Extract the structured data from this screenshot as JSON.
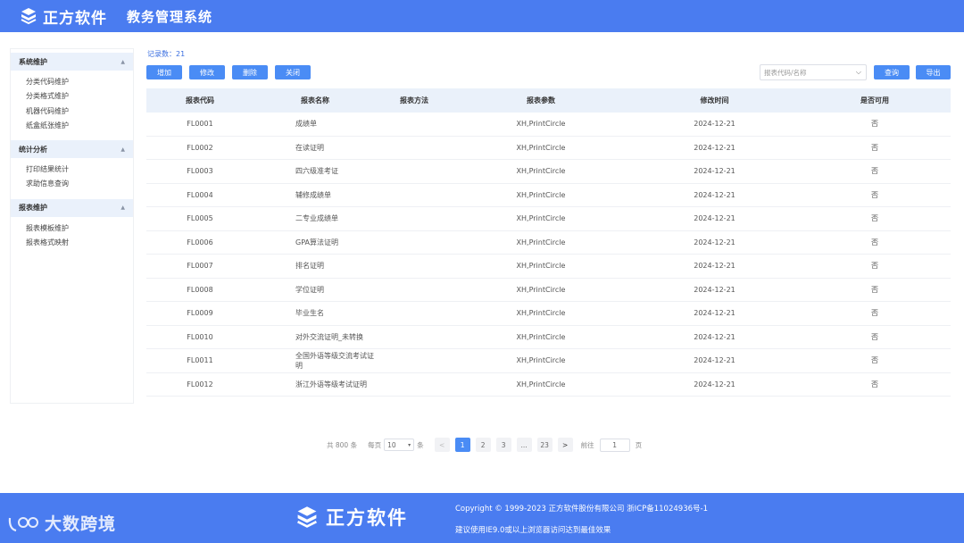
{
  "header": {
    "brand": "正方软件",
    "system_title": "教务管理系统"
  },
  "sidebar": {
    "groups": [
      {
        "title": "系统维护",
        "items": [
          "分类代码维护",
          "分类格式维护",
          "机器代码维护",
          "纸盒纸张维护"
        ]
      },
      {
        "title": "统计分析",
        "items": [
          "打印结果统计",
          "求助信息查询"
        ]
      },
      {
        "title": "报表维护",
        "items": [
          "报表模板维护",
          "报表格式映射"
        ]
      }
    ]
  },
  "toolbar": {
    "record_count": "记录数：21",
    "add": "增加",
    "edit": "修改",
    "delete": "删除",
    "close": "关闭",
    "search_placeholder": "报表代码/名称",
    "query": "查询",
    "export": "导出"
  },
  "table": {
    "headers": [
      "报表代码",
      "报表名称",
      "报表方法",
      "报表参数",
      "修改时间",
      "是否可用"
    ],
    "rows": [
      [
        "FL0001",
        "成绩单",
        "",
        "XH,PrintCircle",
        "2024-12-21",
        "否"
      ],
      [
        "FL0002",
        "在读证明",
        "",
        "XH,PrintCircle",
        "2024-12-21",
        "否"
      ],
      [
        "FL0003",
        "四六级准考证",
        "",
        "XH,PrintCircle",
        "2024-12-21",
        "否"
      ],
      [
        "FL0004",
        "辅修成绩单",
        "",
        "XH,PrintCircle",
        "2024-12-21",
        "否"
      ],
      [
        "FL0005",
        "二专业成绩单",
        "",
        "XH,PrintCircle",
        "2024-12-21",
        "否"
      ],
      [
        "FL0006",
        "GPA算法证明",
        "",
        "XH,PrintCircle",
        "2024-12-21",
        "否"
      ],
      [
        "FL0007",
        "排名证明",
        "",
        "XH,PrintCircle",
        "2024-12-21",
        "否"
      ],
      [
        "FL0008",
        "学位证明",
        "",
        "XH,PrintCircle",
        "2024-12-21",
        "否"
      ],
      [
        "FL0009",
        "毕业生名",
        "",
        "XH,PrintCircle",
        "2024-12-21",
        "否"
      ],
      [
        "FL0010",
        "对外交流证明_未转换",
        "",
        "XH,PrintCircle",
        "2024-12-21",
        "否"
      ],
      [
        "FL0011",
        "全国外语等级交流考试证明",
        "",
        "XH,PrintCircle",
        "2024-12-21",
        "否"
      ],
      [
        "FL0012",
        "浙江外语等级考试证明",
        "",
        "XH,PrintCircle",
        "2024-12-21",
        "否"
      ]
    ]
  },
  "pagination": {
    "total": "共 800 条",
    "per_page_label": "每页",
    "per_page_value": "10",
    "per_page_unit": "条",
    "prev": "<",
    "pages": [
      "1",
      "2",
      "3",
      "...",
      "23"
    ],
    "active_page": "1",
    "next": ">",
    "goto_label": "前往",
    "goto_value": "1",
    "goto_unit": "页"
  },
  "footer": {
    "brand": "正方软件",
    "copyright": "Copyright © 1999-2023 正方软件股份有限公司 浙ICP备11024936号-1",
    "suggestion": "建议使用IE9.0或以上浏览器访问达到最佳效果",
    "watermark": "大数跨境"
  },
  "colors": {
    "primary": "#4a7cf0",
    "button": "#4a8cf5",
    "table_header_bg": "#eaf1fa",
    "side_head_bg": "#eaf1fb"
  }
}
